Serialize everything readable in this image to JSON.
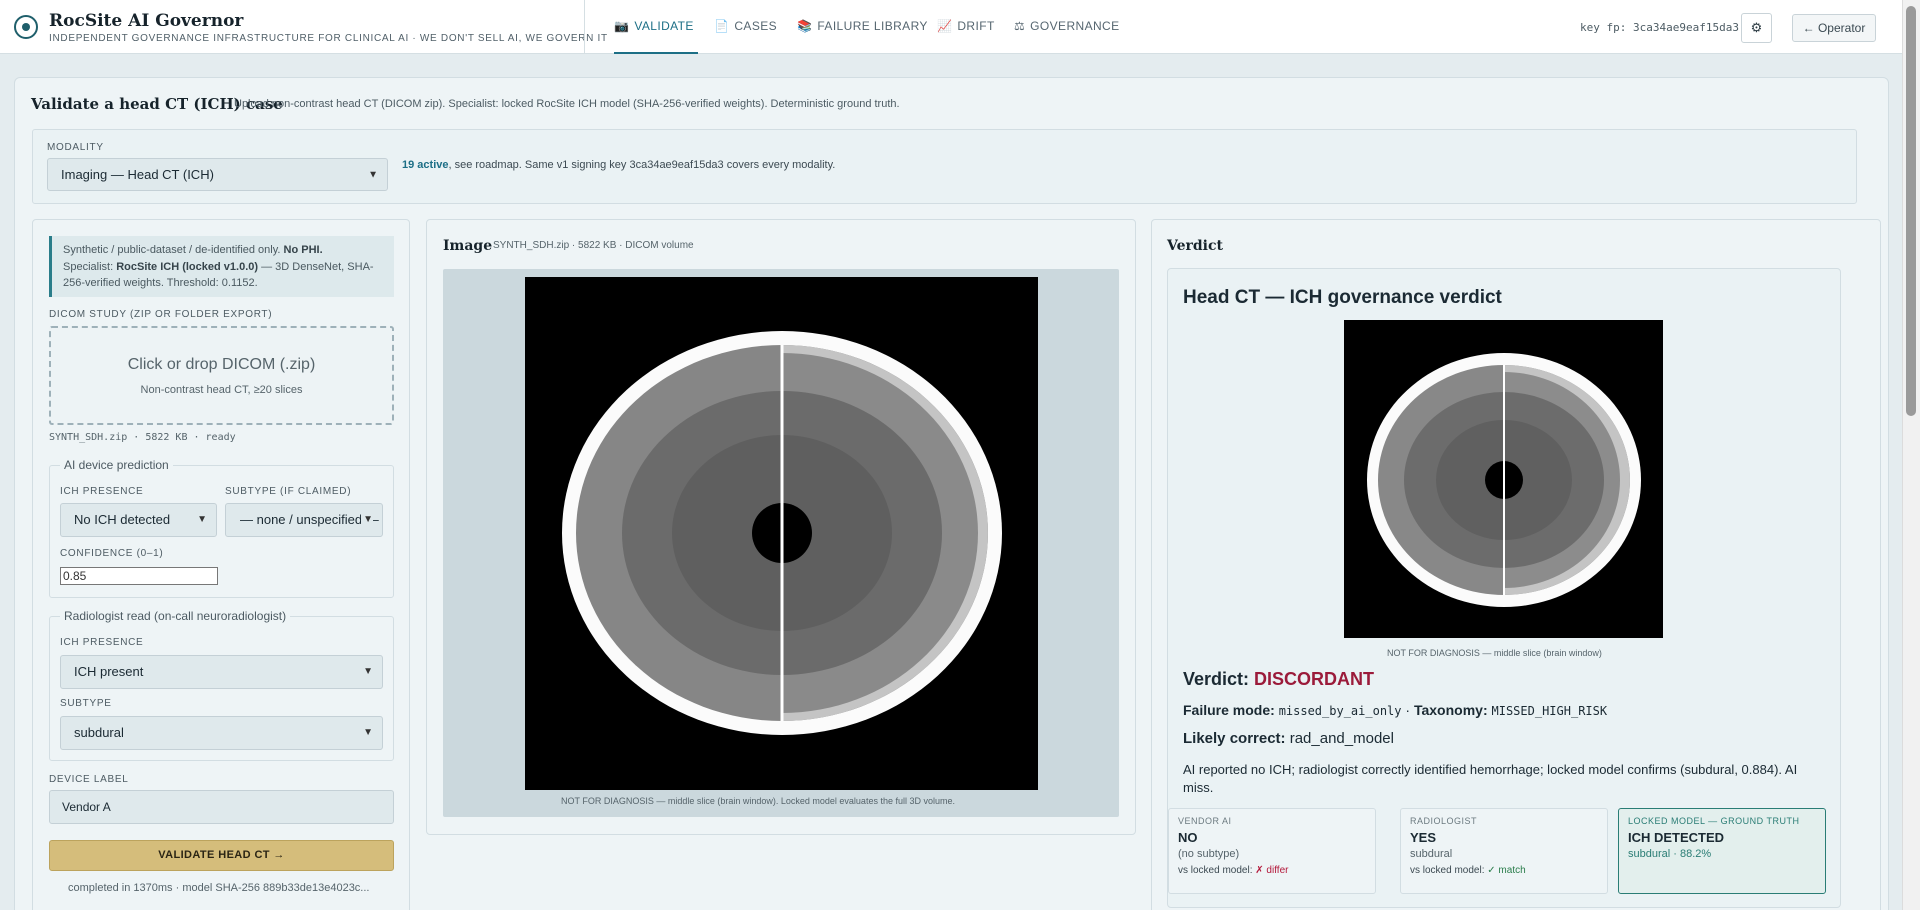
{
  "brand": {
    "title": "RocSite AI Governor",
    "tagline": "INDEPENDENT GOVERNANCE INFRASTRUCTURE FOR CLINICAL AI · WE DON'T SELL AI, WE GOVERN IT"
  },
  "nav": {
    "tabs": [
      {
        "label": "VALIDATE",
        "icon": "📷",
        "active": true
      },
      {
        "label": "CASES",
        "icon": "📄"
      },
      {
        "label": "FAILURE LIBRARY",
        "icon": "📚"
      },
      {
        "label": "DRIFT",
        "icon": "📈"
      },
      {
        "label": "GOVERNANCE",
        "icon": "⚖"
      }
    ],
    "key_fp": "key fp: 3ca34ae9eaf15da3",
    "settings_icon": "⚙",
    "operator_label": "← Operator"
  },
  "page": {
    "title": "Validate a head CT (ICH) case",
    "subtitle": "Upload non-contrast head CT (DICOM zip). Specialist: locked RocSite ICH model (SHA-256-verified weights). Deterministic ground truth."
  },
  "modality": {
    "label": "MODALITY",
    "value": "Imaging — Head CT (ICH)",
    "active_count": "19 active",
    "note": ", see roadmap. Same v1 signing key 3ca34ae9eaf15da3 covers every modality."
  },
  "left": {
    "notice_a": "Synthetic / public-dataset / de-identified only. ",
    "notice_b": "No PHI.",
    "notice_c": "Specialist: ",
    "notice_d": "RocSite ICH (locked v1.0.0)",
    "notice_e": " — 3D DenseNet, SHA-256-verified weights. Threshold: 0.1152.",
    "dicom_label": "DICOM STUDY (ZIP OR FOLDER EXPORT)",
    "drop_main": "Click or drop DICOM (.zip)",
    "drop_sub": "Non-contrast head CT, ≥20 slices",
    "file_line": "SYNTH_SDH.zip · 5822 KB · ready",
    "ai": {
      "legend": "AI device prediction",
      "presence_label": "ICH PRESENCE",
      "presence_value": "No ICH detected",
      "subtype_label": "SUBTYPE (IF CLAIMED)",
      "subtype_value": "— none / unspecified —",
      "confidence_label": "CONFIDENCE (0–1)",
      "confidence_value": "0.85"
    },
    "rad": {
      "legend": "Radiologist read (on-call neuroradiologist)",
      "presence_label": "ICH PRESENCE",
      "presence_value": "ICH present",
      "subtype_label": "SUBTYPE",
      "subtype_value": "subdural"
    },
    "device_label": "DEVICE LABEL",
    "device_value": "Vendor A",
    "validate_label": "VALIDATE HEAD CT →",
    "completed": "completed in 1370ms · model SHA-256 889b33de13e4023c..."
  },
  "image": {
    "title": "Image",
    "sub": "SYNTH_SDH.zip · 5822 KB · DICOM volume",
    "caption": "NOT FOR DIAGNOSIS — middle slice (brain window). Locked model evaluates the full 3D volume."
  },
  "verdict": {
    "title": "Verdict",
    "heading": "Head CT — ICH governance verdict",
    "thumb_caption": "NOT FOR DIAGNOSIS — middle slice (brain window)",
    "verdict_label": "Verdict: ",
    "verdict_value": "DISCORDANT",
    "fm_label": "Failure mode: ",
    "fm_value": "missed_by_ai_only",
    "sep": " · ",
    "tax_label": "Taxonomy: ",
    "tax_value": "MISSED_HIGH_RISK",
    "lc_label": "Likely correct: ",
    "lc_value": "rad_and_model",
    "description": "AI reported no ICH; radiologist correctly identified hemorrhage; locked model confirms (subdural, 0.884). AI miss.",
    "cards": [
      {
        "title": "VENDOR AI",
        "value": "NO",
        "sub": "(no subtype)",
        "cmp": "vs locked model: ",
        "cmp_val": "✗ differ"
      },
      {
        "title": "RADIOLOGIST",
        "value": "YES",
        "sub": "subdural",
        "cmp": "vs locked model: ",
        "cmp_val": "✓ match"
      },
      {
        "title": "LOCKED MODEL — GROUND TRUTH",
        "value": "ICH DETECTED",
        "sub": "subdural · 88.2%"
      }
    ]
  }
}
